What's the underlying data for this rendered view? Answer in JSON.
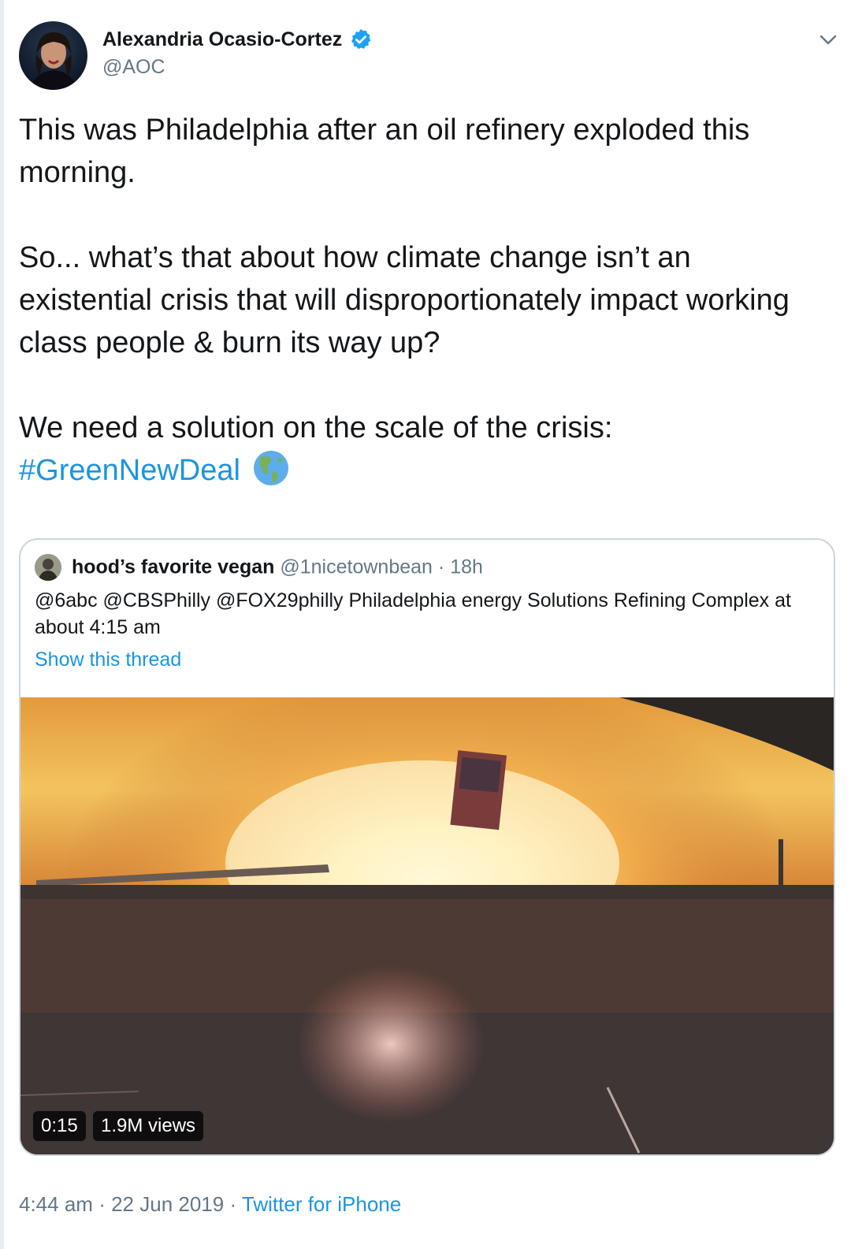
{
  "author": {
    "display_name": "Alexandria Ocasio-Cortez",
    "handle": "@AOC",
    "verified": true
  },
  "tweet": {
    "paragraphs": [
      "This was Philadelphia after an oil refinery exploded this morning.",
      "So... what’s that about how climate change isn’t an existential crisis that will disproportionately impact working class people & burn its way up?",
      "We need a solution on the scale of the crisis:"
    ],
    "hashtag": "#GreenNewDeal",
    "emoji": "🌎"
  },
  "quoted_tweet": {
    "display_name": "hood’s favorite vegan",
    "handle": "@1nicetownbean",
    "separator": "·",
    "time": "18h",
    "text": "@6abc @CBSPhilly @FOX29philly Philadelphia energy Solutions Refining Complex at about 4:15 am",
    "show_thread": "Show this thread",
    "video": {
      "duration": "0:15",
      "views": "1.9M views"
    }
  },
  "footer": {
    "time": "4:44 am",
    "date": "22 Jun 2019",
    "separator": "·",
    "source": "Twitter for iPhone"
  },
  "colors": {
    "link": "#1b95e0",
    "verified": "#1da1f2",
    "secondary_text": "#657786",
    "border": "#ccd6dd"
  },
  "icons": [
    "verified-badge-icon",
    "chevron-down-icon",
    "globe-americas-icon"
  ]
}
